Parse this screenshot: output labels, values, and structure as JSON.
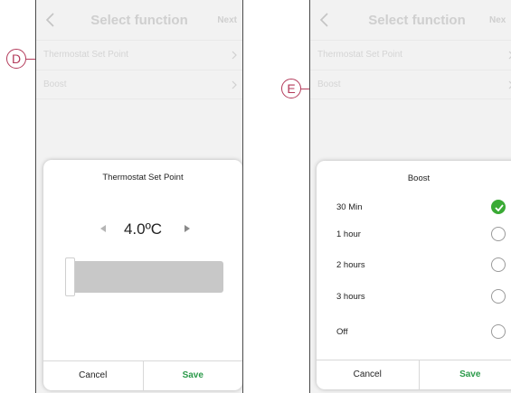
{
  "left_screen": {
    "header": {
      "title": "Select function",
      "next_label": "Next"
    },
    "list": [
      {
        "label": "Thermostat Set Point"
      },
      {
        "label": "Boost"
      }
    ],
    "dialog": {
      "title": "Thermostat Set Point",
      "value": "4.0ºC",
      "slider_fraction": 0.0,
      "cancel_label": "Cancel",
      "save_label": "Save"
    },
    "callout": "D"
  },
  "right_screen": {
    "header": {
      "title": "Select function",
      "next_label": "Nex"
    },
    "list": [
      {
        "label": "Thermostat Set Point"
      },
      {
        "label": "Boost"
      }
    ],
    "dialog": {
      "title": "Boost",
      "options": [
        {
          "label": "30 Min",
          "selected": true
        },
        {
          "label": "1 hour",
          "selected": false
        },
        {
          "label": "2 hours",
          "selected": false
        },
        {
          "label": "3 hours",
          "selected": false
        },
        {
          "label": "Off",
          "selected": false
        }
      ],
      "cancel_label": "Cancel",
      "save_label": "Save"
    },
    "callout": "E"
  },
  "colors": {
    "accent_green": "#3aaa35",
    "save_text": "#2b9a4a",
    "callout": "#b33a5a",
    "background": "#f2f2f2"
  },
  "icons": [
    "back-arrow-icon",
    "chevron-right-icon",
    "arrow-left-icon",
    "arrow-right-icon",
    "check-icon"
  ]
}
